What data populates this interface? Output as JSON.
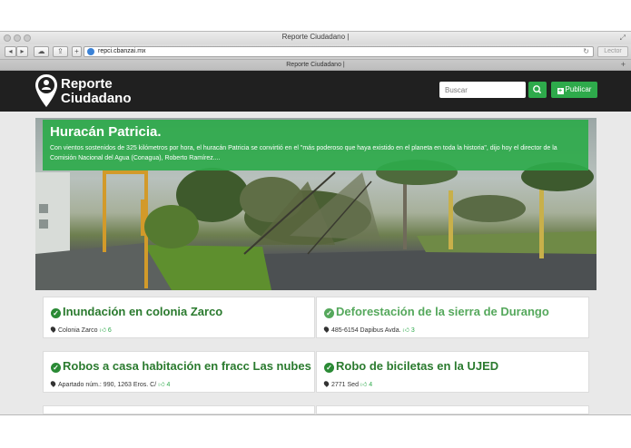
{
  "browser": {
    "window_title": "Reporte Ciudadano |",
    "url": "repci.cbanzai.mx",
    "reader_label": "Lector",
    "tab_title": "Reporte Ciudadano |"
  },
  "header": {
    "logo_line1": "Reporte",
    "logo_line2": "Ciudadano",
    "search_placeholder": "Buscar",
    "publish_label": "Publicar",
    "icon_search": "search-icon",
    "icon_publish": "plus-square-icon"
  },
  "hero": {
    "title": "Huracán Patricia.",
    "text": "Con vientos sostenidos de 325 kilómetros por hora, el huracán Patricia se convirtió en el \"más poderoso que haya existido en el planeta en toda la historia\", dijo hoy el director de la Comisión Nacional del Agua (Conagua), Roberto Ramírez...."
  },
  "reports": [
    {
      "title": "Inundación en colonia Zarco",
      "location": "Colonia Zarco",
      "likes": "6"
    },
    {
      "title": "Deforestación de la sierra de Durango",
      "location": "485-6154 Dapibus Avda.",
      "likes": "3"
    },
    {
      "title": "Robos a casa habitación en fracc Las nubes",
      "location": "Apartado núm.: 990, 1263 Eros. C/",
      "likes": "4"
    },
    {
      "title": "Robo de biciletas en la UJED",
      "location": "2771 Sed",
      "likes": "4"
    }
  ],
  "colors": {
    "brand_green": "#2eaa4b",
    "header_bg": "#202020",
    "title_green": "#2a7a2e"
  }
}
